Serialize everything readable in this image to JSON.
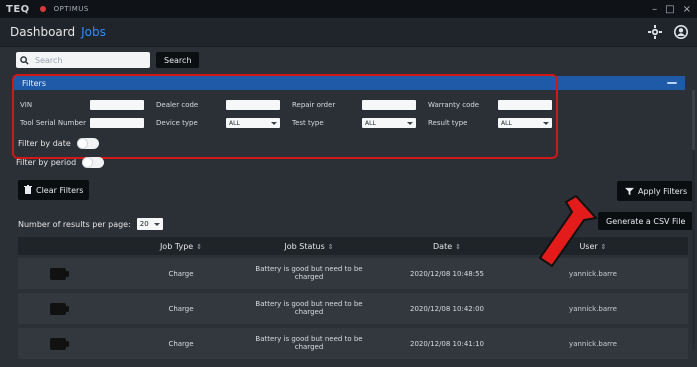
{
  "app": {
    "brand": "TEQ",
    "subbrand": "OPTIMUS",
    "window_controls": [
      "–",
      "□",
      "×"
    ]
  },
  "breadcrumbs": [
    "Dashboard",
    "Jobs"
  ],
  "search": {
    "placeholder": "Search",
    "button": "Search"
  },
  "filters": {
    "header": "Filters",
    "labels": {
      "vin": "VIN",
      "dealer_code": "Dealer code",
      "repair_order": "Repair order",
      "warranty_code": "Warranty code",
      "tool_serial_number": "Tool Serial Number",
      "device_type": "Device type",
      "test_type": "Test type",
      "result_type": "Result type"
    },
    "select_values": {
      "device_type": "ALL",
      "test_type": "ALL",
      "result_type": "ALL"
    },
    "filter_by_date": "Filter by date",
    "filter_by_period": "Filter by period"
  },
  "buttons": {
    "clear_filters": "Clear Filters",
    "apply_filters": "Apply Filters",
    "generate_csv": "Generate a CSV File"
  },
  "results_per_page": {
    "label": "Number of results per page:",
    "value": "20"
  },
  "table": {
    "headers": [
      "Job Type",
      "Job Status",
      "Date",
      "User"
    ],
    "rows": [
      {
        "type": "Charge",
        "status": "Battery is good but need to be charged",
        "date": "2020/12/08 10:48:55",
        "user": "yannick.barre"
      },
      {
        "type": "Charge",
        "status": "Battery is good but need to be charged",
        "date": "2020/12/08 10:42:00",
        "user": "yannick.barre"
      },
      {
        "type": "Charge",
        "status": "Battery is good but need to be charged",
        "date": "2020/12/08 10:41:10",
        "user": "yannick.barre"
      }
    ]
  },
  "colors": {
    "accent": "#2f8cff",
    "filter_outline": "#d01818",
    "arrow": "#e31b1b"
  }
}
